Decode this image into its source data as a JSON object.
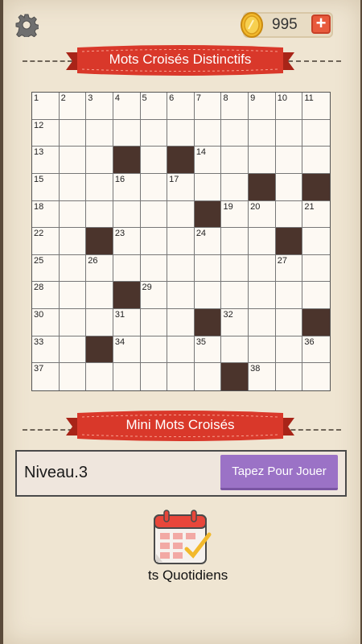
{
  "header": {
    "coins": "995",
    "plus_label": "+",
    "settings_icon": "gear-icon",
    "coin_icon": "coin-icon"
  },
  "main_title": "Mots Croisés Distinctifs",
  "grid": {
    "size": 11,
    "black_cells": [
      [
        2,
        3
      ],
      [
        2,
        5
      ],
      [
        3,
        8
      ],
      [
        3,
        10
      ],
      [
        4,
        6
      ],
      [
        5,
        2
      ],
      [
        5,
        9
      ],
      [
        7,
        3
      ],
      [
        8,
        6
      ],
      [
        8,
        10
      ],
      [
        9,
        2
      ],
      [
        10,
        7
      ]
    ],
    "numbers": [
      {
        "r": 0,
        "c": 0,
        "n": "1"
      },
      {
        "r": 0,
        "c": 1,
        "n": "2"
      },
      {
        "r": 0,
        "c": 2,
        "n": "3"
      },
      {
        "r": 0,
        "c": 3,
        "n": "4"
      },
      {
        "r": 0,
        "c": 4,
        "n": "5"
      },
      {
        "r": 0,
        "c": 5,
        "n": "6"
      },
      {
        "r": 0,
        "c": 6,
        "n": "7"
      },
      {
        "r": 0,
        "c": 7,
        "n": "8"
      },
      {
        "r": 0,
        "c": 8,
        "n": "9"
      },
      {
        "r": 0,
        "c": 9,
        "n": "10"
      },
      {
        "r": 0,
        "c": 10,
        "n": "11"
      },
      {
        "r": 1,
        "c": 0,
        "n": "12"
      },
      {
        "r": 2,
        "c": 0,
        "n": "13"
      },
      {
        "r": 2,
        "c": 6,
        "n": "14"
      },
      {
        "r": 3,
        "c": 0,
        "n": "15"
      },
      {
        "r": 3,
        "c": 3,
        "n": "16"
      },
      {
        "r": 3,
        "c": 5,
        "n": "17"
      },
      {
        "r": 4,
        "c": 0,
        "n": "18"
      },
      {
        "r": 4,
        "c": 7,
        "n": "19"
      },
      {
        "r": 4,
        "c": 8,
        "n": "20"
      },
      {
        "r": 4,
        "c": 10,
        "n": "21"
      },
      {
        "r": 5,
        "c": 0,
        "n": "22"
      },
      {
        "r": 5,
        "c": 3,
        "n": "23"
      },
      {
        "r": 5,
        "c": 6,
        "n": "24"
      },
      {
        "r": 6,
        "c": 0,
        "n": "25"
      },
      {
        "r": 6,
        "c": 2,
        "n": "26"
      },
      {
        "r": 6,
        "c": 9,
        "n": "27"
      },
      {
        "r": 7,
        "c": 0,
        "n": "28"
      },
      {
        "r": 7,
        "c": 4,
        "n": "29"
      },
      {
        "r": 8,
        "c": 0,
        "n": "30"
      },
      {
        "r": 8,
        "c": 3,
        "n": "31"
      },
      {
        "r": 8,
        "c": 7,
        "n": "32"
      },
      {
        "r": 9,
        "c": 0,
        "n": "33"
      },
      {
        "r": 9,
        "c": 3,
        "n": "34"
      },
      {
        "r": 9,
        "c": 6,
        "n": "35"
      },
      {
        "r": 9,
        "c": 10,
        "n": "36"
      },
      {
        "r": 10,
        "c": 0,
        "n": "37"
      },
      {
        "r": 10,
        "c": 8,
        "n": "38"
      }
    ]
  },
  "mini_title": "Mini Mots Croisés",
  "level": {
    "label": "Niveau.3",
    "play_button": "Tapez Pour Jouer"
  },
  "daily": {
    "label": "ts Quotidiens",
    "icon": "calendar-icon"
  },
  "colors": {
    "ribbon": "#d9382a",
    "black_cell": "#4b342c",
    "play_button": "#9b72c6"
  }
}
